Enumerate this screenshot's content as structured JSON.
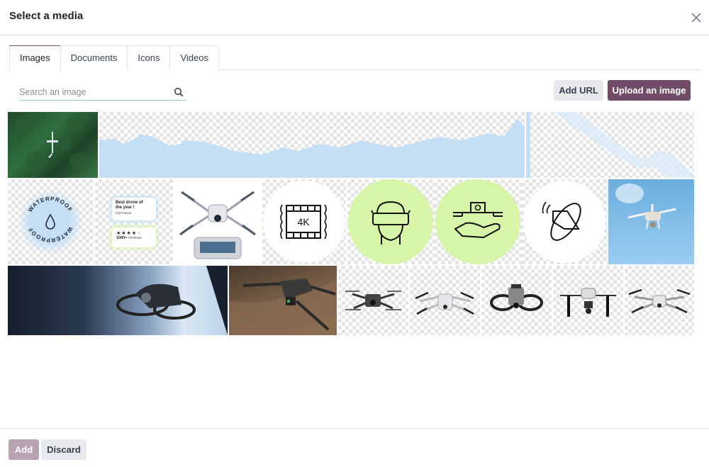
{
  "dialog": {
    "title": "Select a media",
    "close_icon": "close-icon"
  },
  "tabs": [
    {
      "label": "Images",
      "active": true
    },
    {
      "label": "Documents",
      "active": false
    },
    {
      "label": "Icons",
      "active": false
    },
    {
      "label": "Videos",
      "active": false
    }
  ],
  "search": {
    "placeholder": "Search an image",
    "value": "",
    "icon": "search-icon"
  },
  "toolbar": {
    "add_url_label": "Add URL",
    "upload_label": "Upload an image"
  },
  "media": [
    {
      "id": "forest-drone",
      "description": "Aerial forest with drone"
    },
    {
      "id": "blue-mountain-silhouette",
      "description": "Light blue mountain silhouette on transparent"
    },
    {
      "id": "blue-wave-shape",
      "description": "Faded blue wave shape on transparent"
    },
    {
      "id": "waterproof-badge",
      "description": "Waterproof badge",
      "text": "WATERPROOF"
    },
    {
      "id": "review-cards",
      "description": "Review cards",
      "card1_title": "Best drone of the year !",
      "card1_source": "GQ France",
      "rating": 4,
      "rating_max": 5,
      "card2_text": "1000+",
      "card2_suffix": "reviews"
    },
    {
      "id": "mini-drone-controller",
      "description": "Mini drone with controller"
    },
    {
      "id": "4k-icon",
      "description": "4K film icon",
      "text": "4K"
    },
    {
      "id": "vr-goggles-icon",
      "description": "FPV goggles head icon"
    },
    {
      "id": "drone-hand-icon",
      "description": "Drone on hand icon"
    },
    {
      "id": "rotation-icon",
      "description": "Rotation / orbit icon"
    },
    {
      "id": "drone-sky",
      "description": "Drone flying in blue sky"
    },
    {
      "id": "avata-banner",
      "description": "Avata drone banner"
    },
    {
      "id": "mavic-desert",
      "description": "Mavic drone over terrain"
    },
    {
      "id": "fpv-drone",
      "description": "FPV drone"
    },
    {
      "id": "air-drone",
      "description": "Air drone"
    },
    {
      "id": "avata-drone",
      "description": "Avata drone"
    },
    {
      "id": "inspire-drone",
      "description": "Inspire drone"
    },
    {
      "id": "mini-drone",
      "description": "Mini drone"
    }
  ],
  "footer": {
    "add_label": "Add",
    "discard_label": "Discard"
  },
  "colors": {
    "primary": "#714b67",
    "primary_disabled": "#b8a3b3",
    "secondary": "#e7e9ed",
    "lime": "#d6f5a8",
    "sky": "#8ec5ec",
    "pale_blue": "#c3def5"
  }
}
